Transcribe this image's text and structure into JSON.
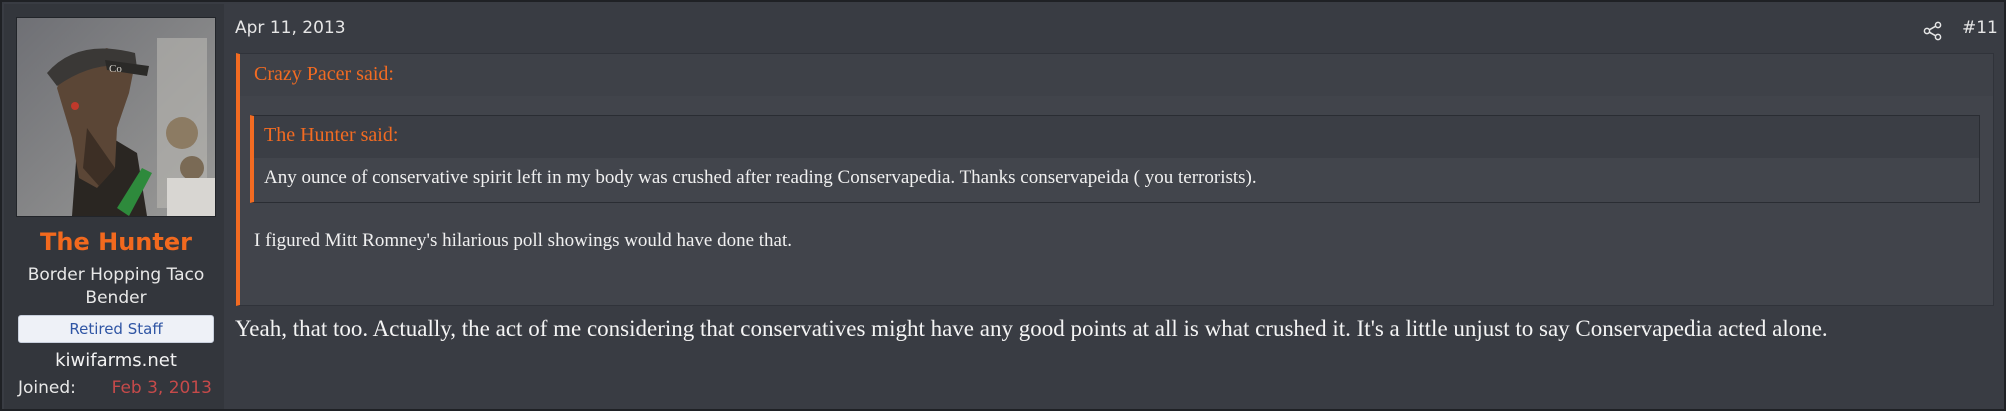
{
  "user": {
    "name": "The Hunter",
    "title": "Border Hopping Taco Bender",
    "banner": "Retired Staff",
    "site": "kiwifarms.net",
    "joined_label": "Joined:",
    "joined_value": "Feb 3, 2013",
    "avatar_icon": "avatar-image"
  },
  "post": {
    "date": "Apr 11, 2013",
    "number": "#11",
    "share_icon": "share-icon",
    "outer_quote": {
      "author": "Crazy Pacer said:",
      "inner_quote": {
        "author": "The Hunter said:",
        "text": "Any ounce of conservative spirit left in my body was crushed after reading Conservapedia. Thanks conservapeida ( you terrorists)."
      },
      "text": "I figured Mitt Romney's hilarious poll showings would have done that."
    },
    "body": "Yeah, that too. Actually, the act of me considering that conservatives might have any good points at all is what crushed it. It's a little unjust to say Conservapedia acted alone."
  },
  "colors": {
    "accent": "#f26b22",
    "background": "#393c43",
    "joined_date": "#c64a4a",
    "banner_text": "#2f55a4"
  }
}
